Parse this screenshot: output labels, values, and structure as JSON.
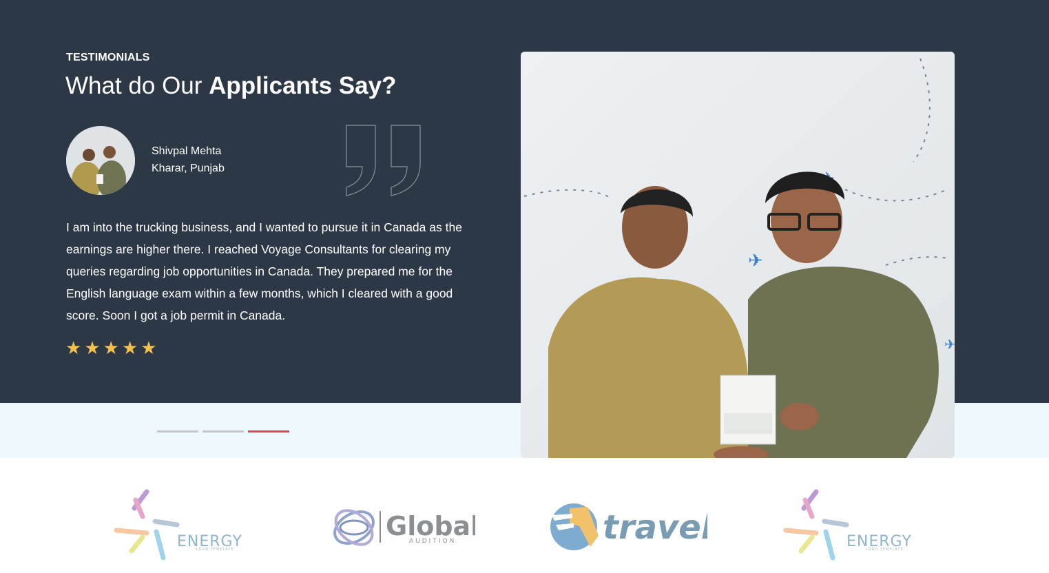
{
  "section": {
    "eyebrow": "TESTIMONIALS",
    "heading_regular": "What do Our ",
    "heading_bold": "Applicants Say?"
  },
  "testimonial": {
    "name": "Shivpal Mehta",
    "location": "Kharar, Punjab",
    "text": "I am into the trucking business, and I wanted to pursue it in Canada as the earnings are higher there. I reached Voyage Consultants for clearing my queries regarding job opportunities in Canada. They prepared me for the English language exam within a few months, which I cleared with a good score. Soon I got a job permit in Canada.",
    "rating": 5,
    "star_glyph": "★"
  },
  "slider": {
    "total": 3,
    "active_index": 2
  },
  "logos": [
    {
      "icon": "energy-logo",
      "name": "ENERGY",
      "tagline": "LOGO TEMPLATE"
    },
    {
      "icon": "global-audition-logo",
      "name": "Global",
      "tagline": "AUDITION"
    },
    {
      "icon": "travel-logo",
      "name": "travel",
      "tagline": ""
    },
    {
      "icon": "energy-logo",
      "name": "ENERGY",
      "tagline": "LOGO TEMPLATE"
    }
  ],
  "colors": {
    "dark_bg": "#2d3846",
    "light_strip": "#eef9fd",
    "star": "#f7c04a",
    "active_dot": "#e2445c",
    "inactive_dot": "#c4c8cb"
  }
}
